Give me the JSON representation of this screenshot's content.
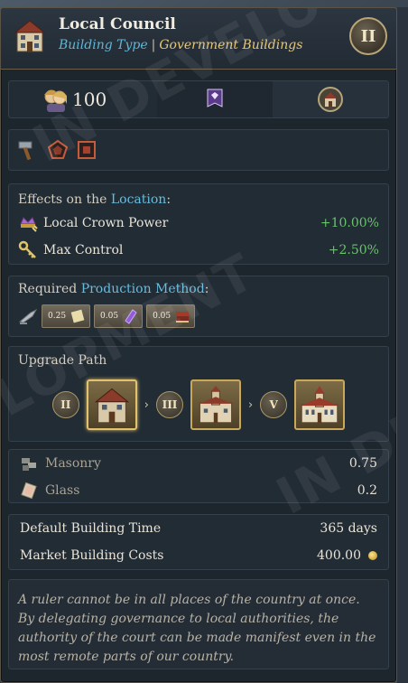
{
  "header": {
    "title": "Local Council",
    "subtitle_key": "Building Type",
    "subtitle_sep": "|",
    "subtitle_value": "Government Buildings",
    "tier": "II"
  },
  "stats": {
    "population": "100"
  },
  "effects": {
    "title_prefix": "Effects on the",
    "title_highlight": "Location",
    "title_suffix": ":",
    "items": [
      {
        "name": "Local Crown Power",
        "value": "+10.00%",
        "icon": "crown-power-icon"
      },
      {
        "name": "Max Control",
        "value": "+2.50%",
        "icon": "key-icon"
      }
    ]
  },
  "production": {
    "title_prefix": "Required",
    "title_highlight": "Production Method",
    "title_suffix": ":",
    "inputs": [
      {
        "amount": "0.25",
        "icon": "paper-icon"
      },
      {
        "amount": "0.05",
        "icon": "crystal-icon"
      },
      {
        "amount": "0.05",
        "icon": "books-icon"
      }
    ]
  },
  "upgrade": {
    "title": "Upgrade Path",
    "steps": [
      {
        "tier": "II",
        "icon": "house-icon"
      },
      {
        "tier": "III",
        "icon": "townhall-icon"
      },
      {
        "tier": "V",
        "icon": "cityhall-icon"
      }
    ]
  },
  "materials": [
    {
      "name": "Masonry",
      "value": "0.75",
      "icon": "masonry-icon"
    },
    {
      "name": "Glass",
      "value": "0.2",
      "icon": "glass-icon"
    }
  ],
  "costs": {
    "time_label": "Default Building Time",
    "time_value": "365 days",
    "market_label": "Market Building Costs",
    "market_value": "400.00"
  },
  "flavor": "A ruler cannot be in all places of the country at once. By delegating governance to local authorities, the authority of the court can be made manifest even in the most remote parts of our country.",
  "watermark": {
    "w1": "IN DEVELO",
    "w2": "LOPMENT",
    "w3": "IN DE"
  },
  "colors": {
    "accent_blue": "#66bde0",
    "accent_gold": "#e6c77a",
    "positive_green": "#68c36b"
  }
}
